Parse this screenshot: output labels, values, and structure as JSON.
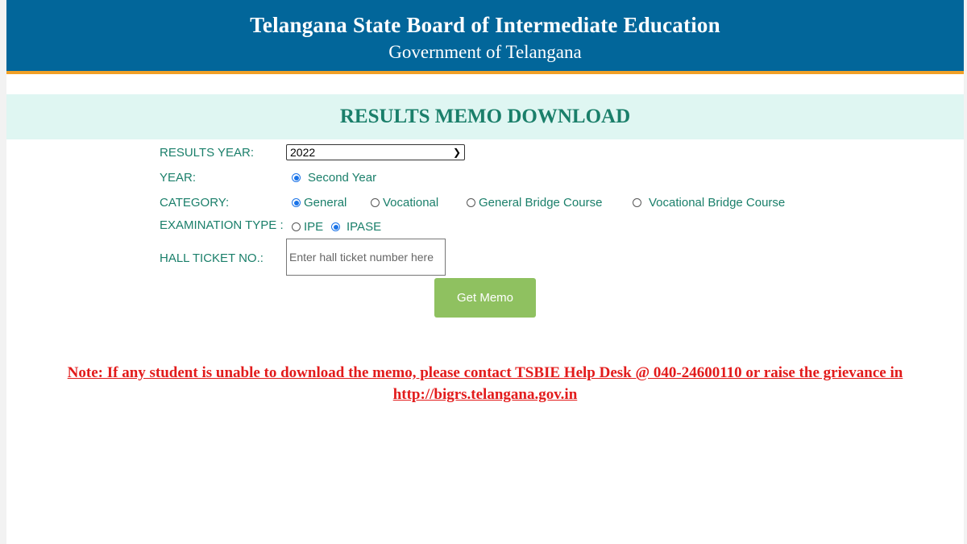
{
  "header": {
    "title": "Telangana State Board of Intermediate Education",
    "subtitle": "Government of Telangana"
  },
  "banner": {
    "title": "RESULTS MEMO DOWNLOAD"
  },
  "form": {
    "results_year": {
      "label": "RESULTS YEAR:",
      "selected": "2022"
    },
    "year": {
      "label": "YEAR:",
      "options": [
        {
          "label": "Second Year",
          "checked": true
        }
      ]
    },
    "category": {
      "label": "CATEGORY:",
      "options": [
        {
          "label": "General",
          "checked": true
        },
        {
          "label": "Vocational",
          "checked": false
        },
        {
          "label": "General Bridge Course",
          "checked": false
        },
        {
          "label": "Vocational Bridge Course",
          "checked": false
        }
      ]
    },
    "exam_type": {
      "label": "EXAMINATION TYPE :",
      "options": [
        {
          "label": "IPE",
          "checked": false
        },
        {
          "label": "IPASE",
          "checked": true
        }
      ]
    },
    "hall_ticket": {
      "label": "HALL TICKET NO.:",
      "placeholder": "Enter hall ticket number here",
      "value": ""
    },
    "submit_label": "Get Memo"
  },
  "note": {
    "text": "Note: If any student is unable to download the memo, please contact TSBIE Help Desk @ 040-24600110 or raise the grievance in",
    "link": "http://bigrs.telangana.gov.in"
  },
  "colors": {
    "header_bg": "#02669a",
    "header_border": "#f0a027",
    "banner_bg": "#dff6f2",
    "label": "#1a7f6a",
    "note": "#e21b1b",
    "button": "#8fc160"
  }
}
